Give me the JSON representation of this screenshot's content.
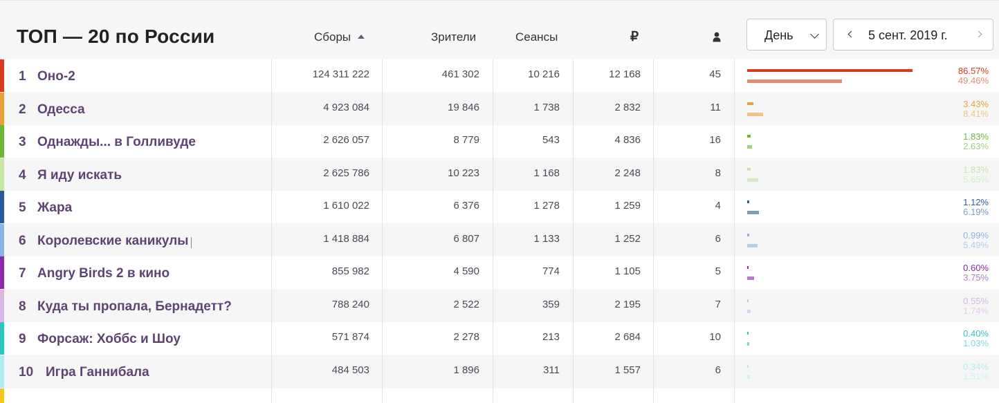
{
  "header": {
    "title": "ТОП — 20 по России",
    "col_sbory": "Сборы",
    "col_zriteli": "Зрители",
    "col_seansy": "Сеансы",
    "col_rub": "₽",
    "period_label": "День",
    "date": "5 сент. 2019 г."
  },
  "colors": {
    "accent_text": "#5e4470"
  },
  "rows": [
    {
      "rank": "1",
      "title": "Оно-2",
      "sbory": "124 311 222",
      "zriteli": "461 302",
      "seansy": "10 216",
      "rub": "12 168",
      "people": "45",
      "p1": "86.57%",
      "p2": "49.46%",
      "v1": 86.57,
      "v2": 49.46,
      "color": "#d63b1f",
      "color2": "#e88a73"
    },
    {
      "rank": "2",
      "title": "Одесса",
      "sbory": "4 923 084",
      "zriteli": "19 846",
      "seansy": "1 738",
      "rub": "2 832",
      "people": "11",
      "p1": "3.43%",
      "p2": "8.41%",
      "v1": 3.43,
      "v2": 8.41,
      "color": "#e8a23c",
      "color2": "#efc384"
    },
    {
      "rank": "3",
      "title": "Однажды... в Голливуде",
      "sbory": "2 626 057",
      "zriteli": "8 779",
      "seansy": "543",
      "rub": "4 836",
      "people": "16",
      "p1": "1.83%",
      "p2": "2.63%",
      "v1": 1.83,
      "v2": 2.63,
      "color": "#6eb53a",
      "color2": "#9fd07c"
    },
    {
      "rank": "4",
      "title": "Я иду искать",
      "sbory": "2 625 786",
      "zriteli": "10 223",
      "seansy": "1 168",
      "rub": "2 248",
      "people": "8",
      "p1": "1.83%",
      "p2": "5.65%",
      "v1": 1.83,
      "v2": 5.65,
      "color": "#c6e6a8",
      "color2": "#d5edc0"
    },
    {
      "rank": "5",
      "title": "Жара",
      "sbory": "1 610 022",
      "zriteli": "6 376",
      "seansy": "1 278",
      "rub": "1 259",
      "people": "4",
      "p1": "1.12%",
      "p2": "6.19%",
      "v1": 1.12,
      "v2": 6.19,
      "color": "#2a5a9a",
      "color2": "#7a9cc4"
    },
    {
      "rank": "6",
      "title": "Королевские каникулы",
      "sbory": "1 418 884",
      "zriteli": "6 807",
      "seansy": "1 133",
      "rub": "1 252",
      "people": "6",
      "p1": "0.99%",
      "p2": "5.49%",
      "v1": 0.99,
      "v2": 5.49,
      "color": "#8fb2e0",
      "color2": "#b5cdec"
    },
    {
      "rank": "7",
      "title": "Angry Birds 2 в кино",
      "sbory": "855 982",
      "zriteli": "4 590",
      "seansy": "774",
      "rub": "1 105",
      "people": "5",
      "p1": "0.60%",
      "p2": "3.75%",
      "v1": 0.6,
      "v2": 3.75,
      "color": "#8a2aa6",
      "color2": "#b57dc8"
    },
    {
      "rank": "8",
      "title": "Куда ты пропала, Бернадетт?",
      "sbory": "788 240",
      "zriteli": "2 522",
      "seansy": "359",
      "rub": "2 195",
      "people": "7",
      "p1": "0.55%",
      "p2": "1.74%",
      "v1": 0.55,
      "v2": 1.74,
      "color": "#d8b7e4",
      "color2": "#e5cdee"
    },
    {
      "rank": "9",
      "title": "Форсаж: Хоббс и Шоу",
      "sbory": "571 874",
      "zriteli": "2 278",
      "seansy": "213",
      "rub": "2 684",
      "people": "10",
      "p1": "0.40%",
      "p2": "1.03%",
      "v1": 0.4,
      "v2": 1.03,
      "color": "#2fc4c4",
      "color2": "#7fd9d9"
    },
    {
      "rank": "10",
      "title": "Игра Ганнибала",
      "sbory": "484 503",
      "zriteli": "1 896",
      "seansy": "311",
      "rub": "1 557",
      "people": "6",
      "p1": "0.34%",
      "p2": "1.51%",
      "v1": 0.34,
      "v2": 1.51,
      "color": "#b4ecec",
      "color2": "#cdf2f2"
    }
  ]
}
